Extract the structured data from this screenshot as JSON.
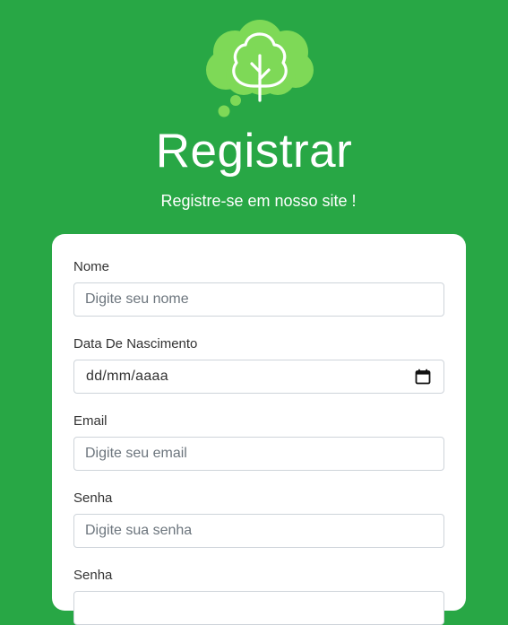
{
  "header": {
    "title": "Registrar",
    "subtitle": "Registre-se em nosso site !",
    "logo_icon": "tree-thought-bubble-icon"
  },
  "form": {
    "nome": {
      "label": "Nome",
      "placeholder": "Digite seu nome"
    },
    "nascimento": {
      "label": "Data De Nascimento",
      "value": "dd/mm/aaaa",
      "icon": "calendar-icon"
    },
    "email": {
      "label": "Email",
      "placeholder": "Digite seu email"
    },
    "senha": {
      "label": "Senha",
      "placeholder": "Digite sua senha"
    },
    "senha_confirm": {
      "label": "Senha"
    }
  },
  "colors": {
    "background": "#28a745",
    "logo_bubble": "#7ed957",
    "card": "#ffffff"
  }
}
